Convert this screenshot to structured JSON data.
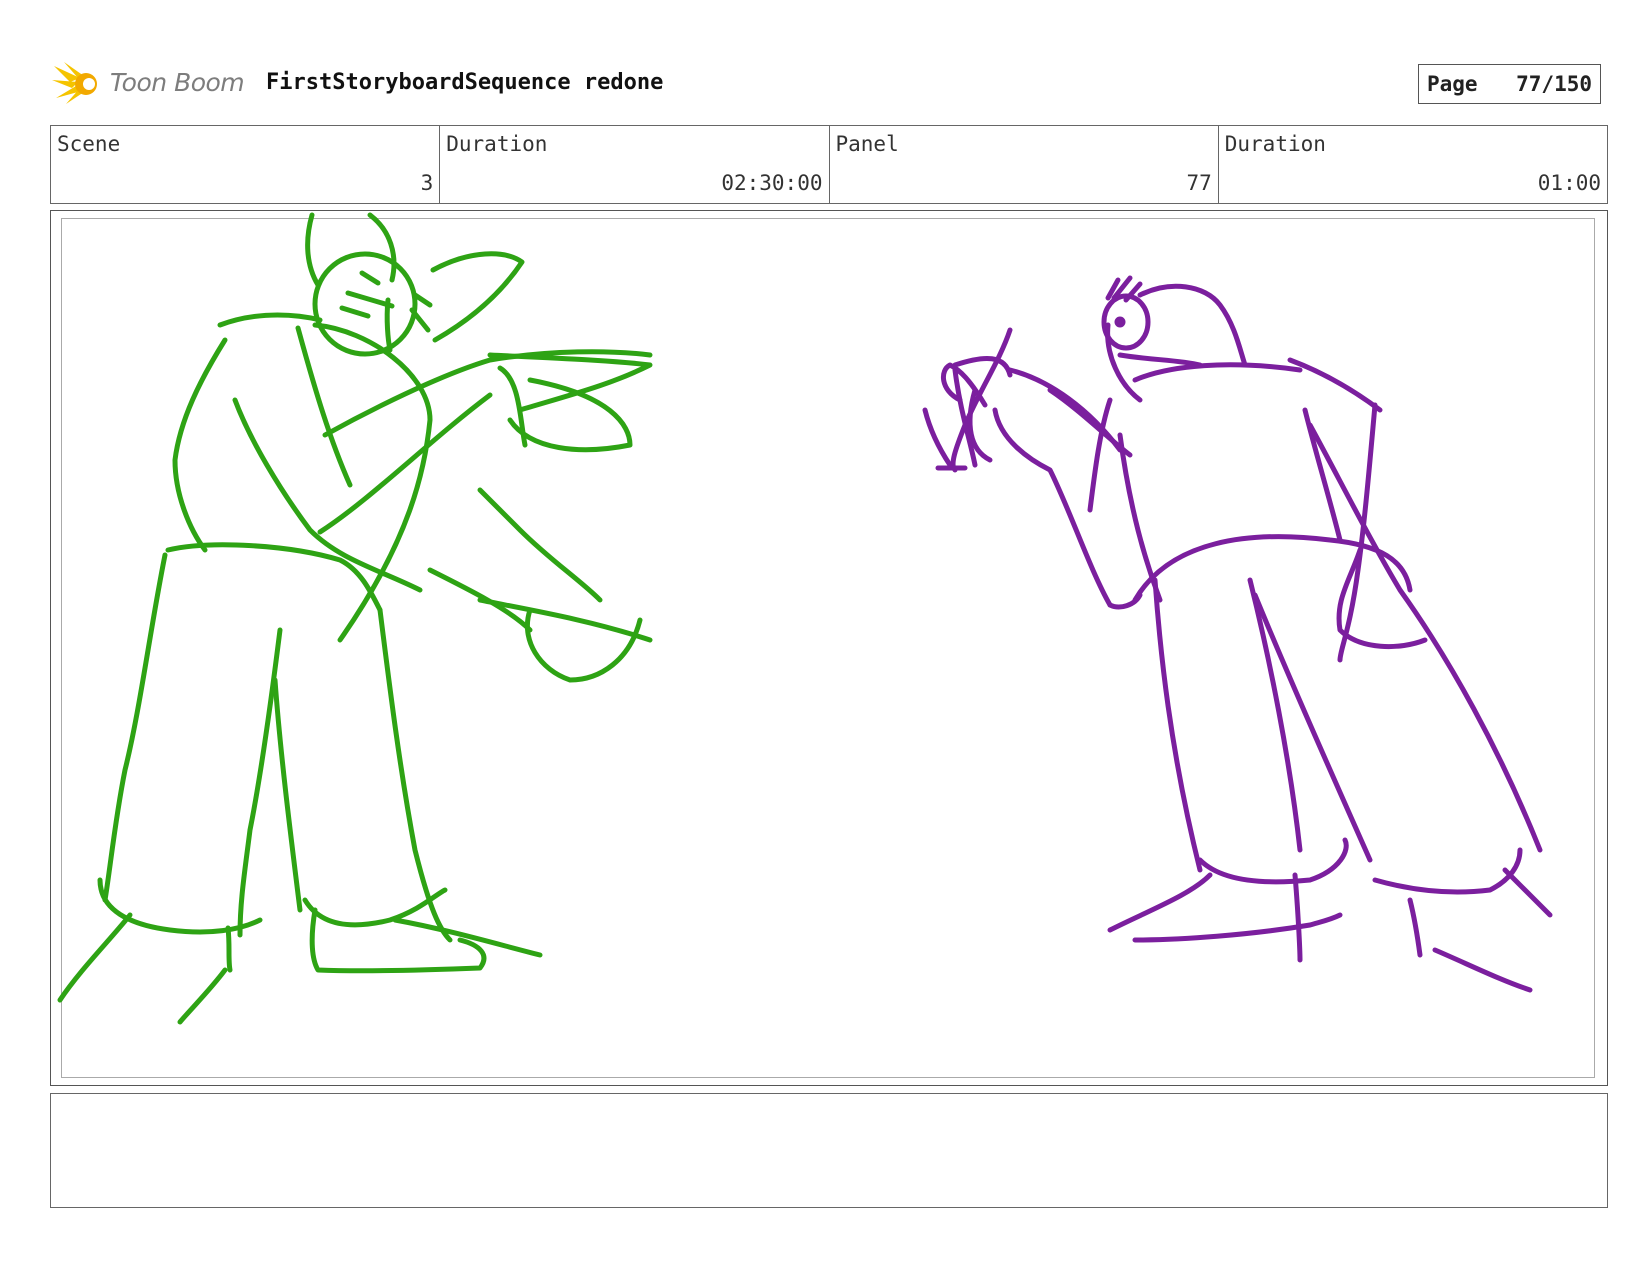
{
  "header": {
    "brand": "Toon Boom",
    "title": "FirstStoryboardSequence redone",
    "page_label": "Page",
    "page_value": "77/150"
  },
  "info": {
    "scene_label": "Scene",
    "scene_value": "3",
    "scene_duration_label": "Duration",
    "scene_duration_value": "02:30:00",
    "panel_label": "Panel",
    "panel_value": "77",
    "panel_duration_label": "Duration",
    "panel_duration_value": "01:00"
  },
  "colors": {
    "green_figure": "#2ea314",
    "purple_figure": "#7b1f9e",
    "logo_yellow": "#f5c400"
  }
}
